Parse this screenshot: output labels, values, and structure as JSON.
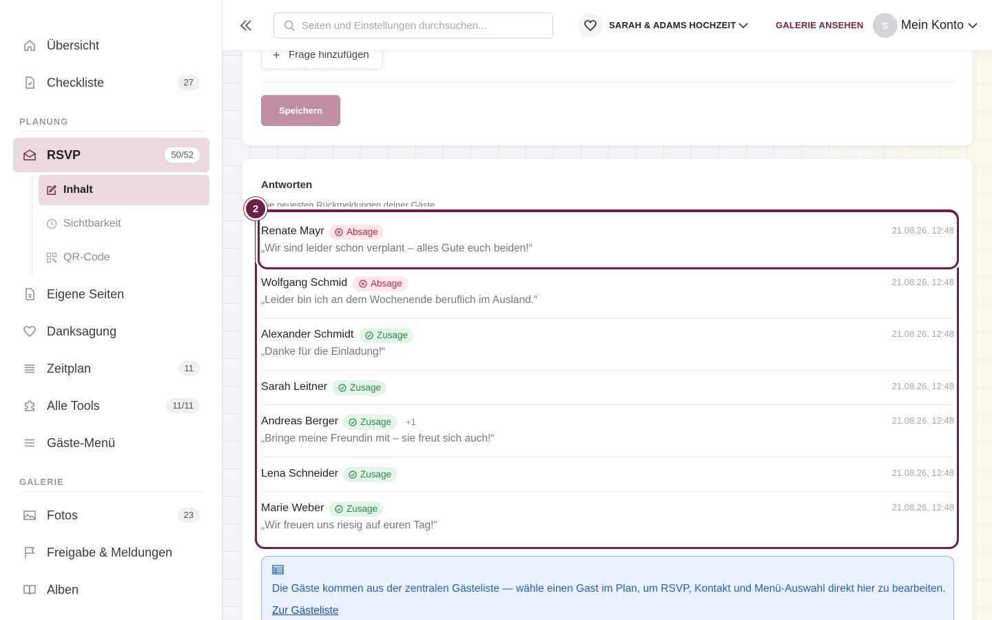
{
  "sidebar": {
    "items": [
      {
        "label": "Übersicht",
        "icon": "home-icon"
      },
      {
        "label": "Checkliste",
        "badge": "27",
        "icon": "checklist-icon"
      }
    ],
    "planning_title": "PLANUNG",
    "rsvp": {
      "label": "RSVP",
      "badge": "50/52"
    },
    "rsvp_sub": [
      {
        "label": "Inhalt",
        "active": true
      },
      {
        "label": "Sichtbarkeit"
      },
      {
        "label": "QR-Code"
      }
    ],
    "planning_items": [
      {
        "label": "Eigene Seiten"
      },
      {
        "label": "Danksagung"
      },
      {
        "label": "Zeitplan",
        "badge": "11"
      },
      {
        "label": "Alle Tools",
        "badge": "11/11"
      },
      {
        "label": "Gäste-Menü"
      }
    ],
    "gallery_title": "GALERIE",
    "gallery_items": [
      {
        "label": "Fotos",
        "badge": "23"
      },
      {
        "label": "Freigabe & Meldungen"
      },
      {
        "label": "Alben"
      }
    ]
  },
  "topbar": {
    "search_placeholder": "Seiten und Einstellungen durchsuchen...",
    "event_name": "SARAH & ADAMS HOCHZEIT",
    "gallery_link": "GALERIE ANSEHEN",
    "avatar_initial": "S",
    "account_label": "Mein Konto"
  },
  "form": {
    "add_question": "Frage hinzufügen",
    "save": "Speichern"
  },
  "answers": {
    "title": "Antworten",
    "subtitle": "Die neuesten Rückmeldungen deiner Gäste",
    "marker": "2",
    "rows": [
      {
        "name": "Renate Mayr",
        "status": "Absage",
        "type": "decline",
        "time": "21.08.26, 12:48",
        "message": "„Wir sind leider schon verplant – alles Gute euch beiden!“"
      },
      {
        "name": "Wolfgang Schmid",
        "status": "Absage",
        "type": "decline",
        "time": "21.08.26, 12:48",
        "message": "„Leider bin ich an dem Wochenende beruflich im Ausland.“"
      },
      {
        "name": "Alexander Schmidt",
        "status": "Zusage",
        "type": "accept",
        "time": "21.08.26, 12:48",
        "message": "„Danke für die Einladung!“"
      },
      {
        "name": "Sarah Leitner",
        "status": "Zusage",
        "type": "accept",
        "time": "21.08.26, 12:48",
        "message": ""
      },
      {
        "name": "Andreas Berger",
        "status": "Zusage",
        "type": "accept",
        "extra": "+1",
        "time": "21.08.26, 12:48",
        "message": "„Bringe meine Freundin mit – sie freut sich auch!“"
      },
      {
        "name": "Lena Schneider",
        "status": "Zusage",
        "type": "accept",
        "time": "21.08.26, 12:48",
        "message": ""
      },
      {
        "name": "Marie Weber",
        "status": "Zusage",
        "type": "accept",
        "time": "21.08.26, 12:48",
        "message": "„Wir freuen uns riesig auf euren Tag!“"
      }
    ]
  },
  "info": {
    "text": "Die Gäste kommen aus der zentralen Gästeliste — wähle einen Gast im Plan, um RSVP, Kontakt und Menü-Auswahl direkt hier zu bearbeiten.",
    "link": "Zur Gästeliste"
  },
  "colors": {
    "brand": "#6f1f45",
    "accent_pink": "#ead9de",
    "decline": "#c0283e",
    "accept": "#2a8a46",
    "info": "#2a5fb8"
  }
}
